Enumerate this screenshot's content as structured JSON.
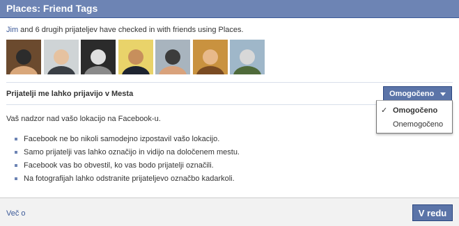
{
  "dialog": {
    "title": "Places: Friend Tags"
  },
  "intro": {
    "friend_name": "Jim",
    "text": " and 6 drugih prijateljev have checked in with friends using Places."
  },
  "friend_photos": [
    {
      "name": "friend-photo-1",
      "colors": [
        "#6b4a2e",
        "#d9a77a",
        "#2c2c2c"
      ]
    },
    {
      "name": "friend-photo-2",
      "colors": [
        "#cfd4d6",
        "#3a3f45",
        "#e6c2a0"
      ]
    },
    {
      "name": "friend-photo-3",
      "colors": [
        "#2b2b2b",
        "#8a8a8a",
        "#e0e0e0"
      ]
    },
    {
      "name": "friend-photo-4",
      "colors": [
        "#e9d36a",
        "#1e2430",
        "#c78f5c"
      ]
    },
    {
      "name": "friend-photo-5",
      "colors": [
        "#a8b4be",
        "#d9a27c",
        "#3c3c3c"
      ]
    },
    {
      "name": "friend-photo-6",
      "colors": [
        "#c9923f",
        "#7a4b22",
        "#e8b98a"
      ]
    },
    {
      "name": "friend-photo-7",
      "colors": [
        "#9fb7c9",
        "#4f6a3a",
        "#d8d8d8"
      ]
    }
  ],
  "setting": {
    "label": "Prijatelji me lahko prijavijo v Mesta",
    "selected_value": "Omogočeno",
    "options": [
      {
        "label": "Omogočeno",
        "checked": true
      },
      {
        "label": "Onemogočeno",
        "checked": false
      }
    ],
    "check_glyph": "✓"
  },
  "description": "Vaš nadzor nad vašo lokacijo na Facebook-u.",
  "bullets": [
    "Facebook ne bo nikoli samodejno izpostavil vašo lokacijo.",
    "Samo prijatelji vas lahko označijo in vidijo na določenem mestu.",
    "Facebook vas bo obvestil, ko vas bodo prijatelji označili.",
    "Na fotografijah lahko odstranite prijateljevo označbo kadarkoli."
  ],
  "footer": {
    "more_link": "Več o",
    "ok_button": "V redu"
  },
  "colors": {
    "header_bg": "#6d84b4",
    "button_bg": "#5b74a8",
    "link": "#3b5998",
    "bullet": "#6d84b4"
  }
}
